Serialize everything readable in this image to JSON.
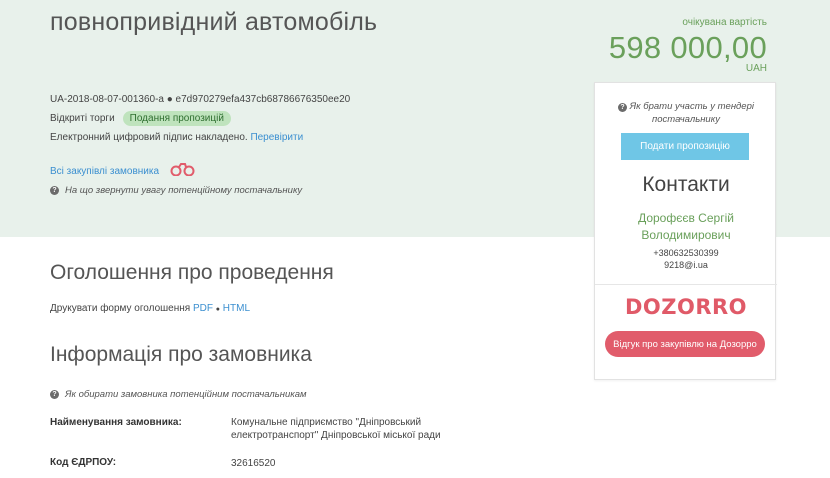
{
  "header": {
    "title": "повнопривідний автомобіль",
    "price_label": "очікувана вартість",
    "price": "598 000,00",
    "currency": "UAH"
  },
  "tender": {
    "id": "UA-2018-08-07-001360-a ● e7d970279efa437cb68786676350ee20",
    "procedure": "Відкриті торги",
    "status": "Подання пропозицій",
    "signature_text": "Електронний цифровий підпис накладено.",
    "verify_link": "Перевірити",
    "buyer_purchases_link": "Всі закупівлі замовника",
    "buyer_help": "На що звернути увагу потенційному постачальнику"
  },
  "announcement": {
    "heading": "Оголошення про проведення",
    "print_label": "Друкувати форму оголошення",
    "pdf": "PDF",
    "separator": "●",
    "html": "HTML"
  },
  "buyer_info": {
    "heading": "Інформація про замовника",
    "help": "Як обирати замовника потенційним постачальникам",
    "name_label": "Найменування замовника:",
    "name_value": "Комунальне підприємство \"Дніпровський електротранспорт\" Дніпровської міської ради",
    "code_label": "Код ЄДРПОУ:",
    "code_value": "32616520"
  },
  "sidebar": {
    "help": "Як брати участь у тендері постачальнику",
    "submit_button": "Подати пропозицію",
    "contacts_heading": "Контакти",
    "contact_name": "Дорофєєв Сергій Володимирович",
    "phone": "+380632530399",
    "email": "9218@i.ua",
    "dozorro_logo": "DOZORRO",
    "dozorro_button": "Відгук про закупівлю на Дозорро"
  },
  "icons": {
    "binoculars": "binoculars-icon",
    "help": "question-circle-icon"
  },
  "colors": {
    "hero_bg": "#e8f1eb",
    "accent_green": "#6aa05b",
    "link_blue": "#3b8fd0",
    "submit_blue": "#6fc6e6",
    "dozorro_red": "#e15c6b"
  }
}
